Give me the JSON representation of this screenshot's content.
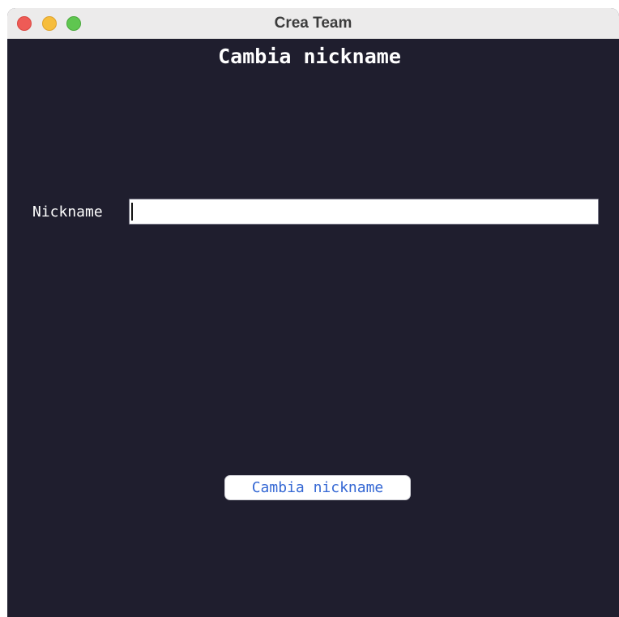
{
  "window": {
    "title": "Crea Team"
  },
  "main": {
    "heading": "Cambia nickname",
    "nickname_label": "Nickname",
    "nickname_value": "",
    "nickname_placeholder": "",
    "submit_label": "Cambia nickname"
  },
  "colors": {
    "background": "#1f1e2e",
    "titlebar": "#ecebeb",
    "button_text": "#3568d4",
    "close": "#ee5b56",
    "minimize": "#f6bd3c",
    "zoom": "#5fc650"
  }
}
